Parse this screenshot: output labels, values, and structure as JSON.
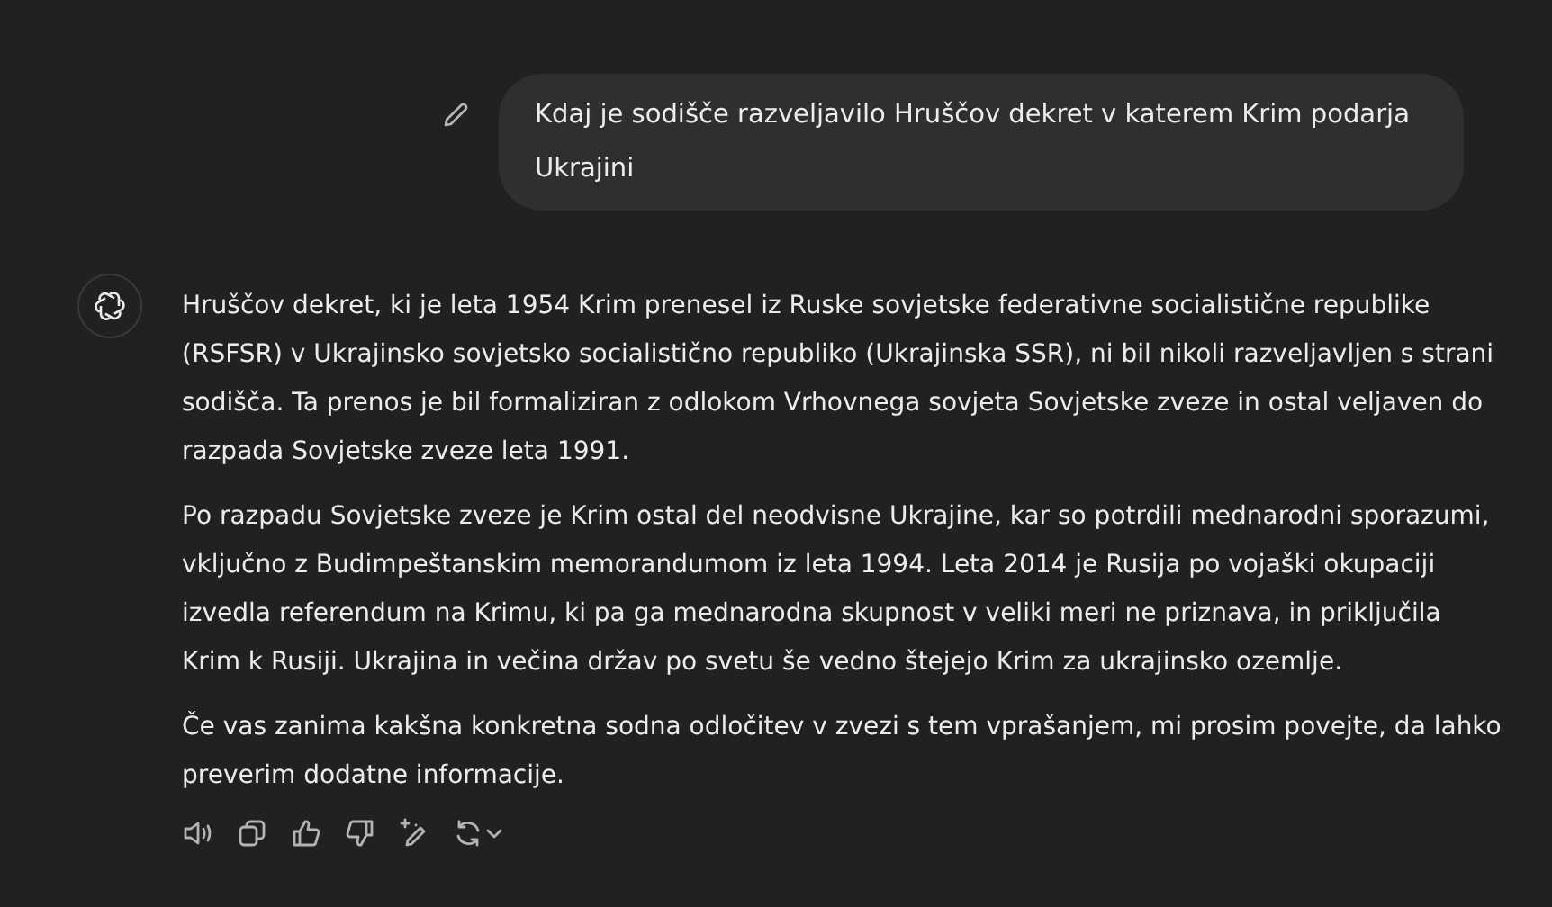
{
  "user_message": {
    "text": "Kdaj je sodišče razveljavilo Hruščov dekret v katerem Krim podarja Ukrajini"
  },
  "assistant_message": {
    "paragraphs": [
      "Hruščov dekret, ki je leta 1954 Krim prenesel iz Ruske sovjetske federativne socialistične republike (RSFSR) v Ukrajinsko sovjetsko socialistično republiko (Ukrajinska SSR), ni bil nikoli razveljavljen s strani sodišča. Ta prenos je bil formaliziran z odlokom Vrhovnega sovjeta Sovjetske zveze in ostal veljaven do razpada Sovjetske zveze leta 1991.",
      "Po razpadu Sovjetske zveze je Krim ostal del neodvisne Ukrajine, kar so potrdili mednarodni sporazumi, vključno z Budimpeštanskim memorandumom iz leta 1994. Leta 2014 je Rusija po vojaški okupaciji izvedla referendum na Krimu, ki pa ga mednarodna skupnost v veliki meri ne priznava, in priključila Krim k Rusiji. Ukrajina in večina držav po svetu še vedno štejejo Krim za ukrajinsko ozemlje.",
      "Če vas zanima kakšna konkretna sodna odločitev v zvezi s tem vprašanjem, mi prosim povejte, da lahko preverim dodatne informacije."
    ]
  },
  "actions": [
    {
      "kind": "speaker"
    },
    {
      "kind": "copy"
    },
    {
      "kind": "thumbs_up"
    },
    {
      "kind": "thumbs_down"
    },
    {
      "kind": "edit"
    },
    {
      "kind": "regenerate"
    }
  ]
}
